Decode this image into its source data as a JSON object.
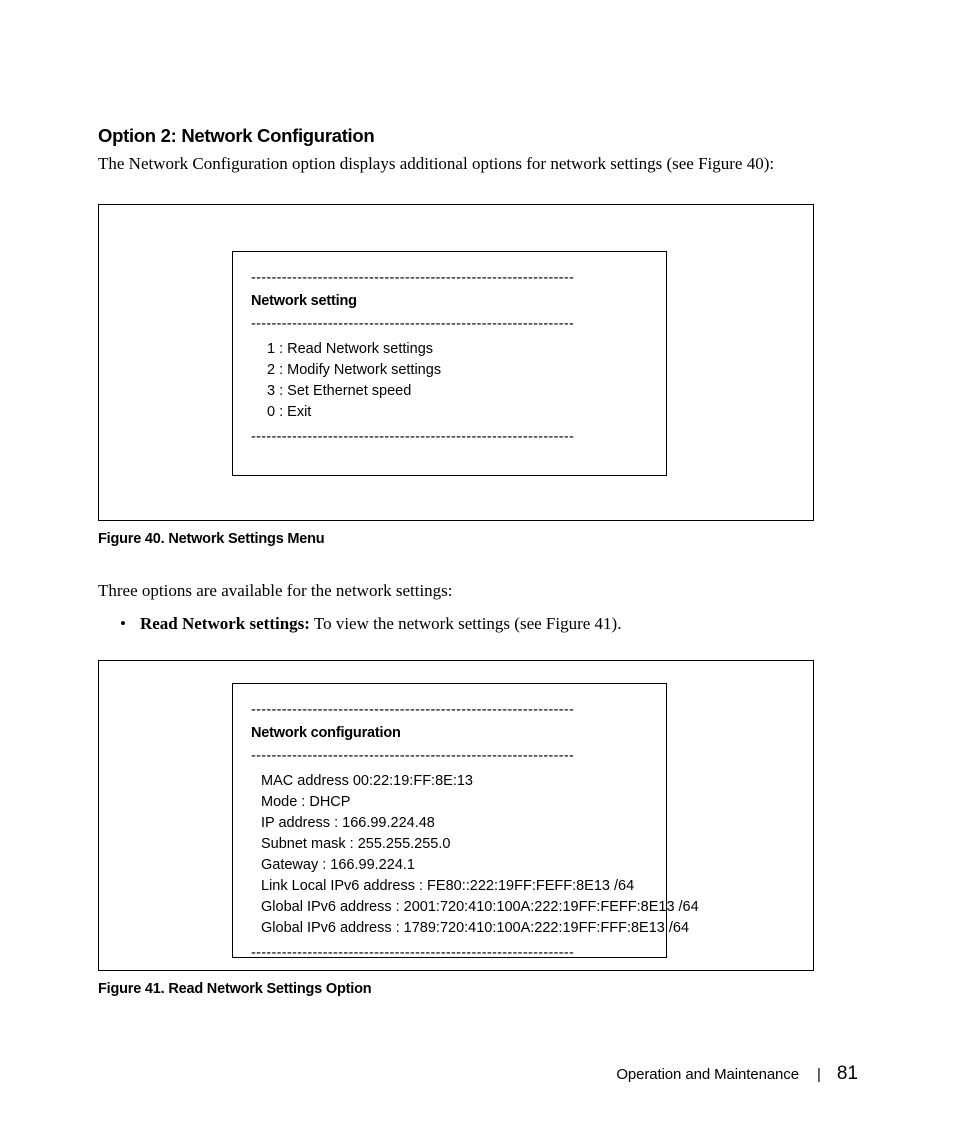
{
  "section_heading": "Option 2: Network Configuration",
  "intro_text": "The Network Configuration option displays additional options for network settings (see Figure 40):",
  "figure40": {
    "dashed": "---------------------------------------------------------------",
    "title": "Network setting",
    "items": {
      "i1": "1 : Read Network settings",
      "i2": "2 : Modify Network settings",
      "i3": "3 : Set Ethernet speed",
      "i0": "0 : Exit"
    },
    "caption": "Figure 40. Network Settings Menu"
  },
  "mid_text": "Three options are available for the network settings:",
  "bullet1": {
    "bold": "Read Network settings:",
    "rest": " To view the network settings (see Figure 41)."
  },
  "figure41": {
    "dashed": "---------------------------------------------------------------",
    "title": "Network configuration",
    "items": {
      "l1": "MAC address 00:22:19:FF:8E:13",
      "l2": "Mode : DHCP",
      "l3": "IP address : 166.99.224.48",
      "l4": "Subnet mask : 255.255.255.0",
      "l5": "Gateway : 166.99.224.1",
      "l6": "Link Local IPv6 address : FE80::222:19FF:FEFF:8E13 /64",
      "l7": "Global IPv6 address : 2001:720:410:100A:222:19FF:FEFF:8E13 /64",
      "l8": "Global IPv6 address : 1789:720:410:100A:222:19FF:FFF:8E13 /64"
    },
    "caption": "Figure 41. Read Network Settings Option"
  },
  "footer": {
    "section": "Operation and Maintenance",
    "sep": "|",
    "page": "81"
  }
}
